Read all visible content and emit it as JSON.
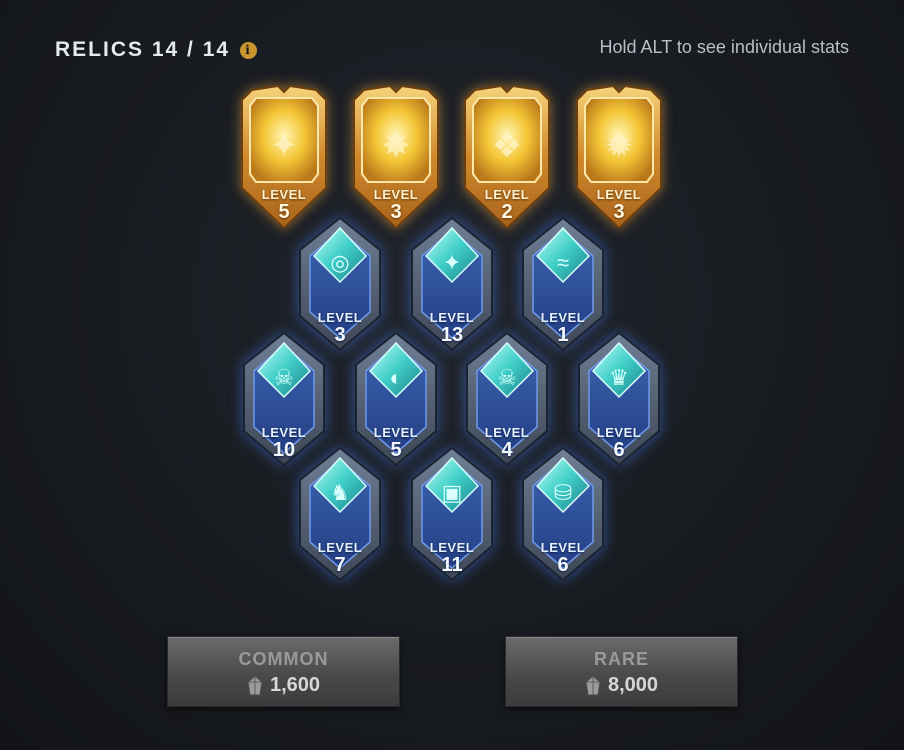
{
  "header": {
    "title": "RELICS 14 / 14",
    "hint": "Hold ALT to see individual stats"
  },
  "level_label": "LEVEL",
  "relics": {
    "gold": [
      {
        "level": "5"
      },
      {
        "level": "3"
      },
      {
        "level": "2"
      },
      {
        "level": "3"
      }
    ],
    "row1": [
      {
        "level": "3"
      },
      {
        "level": "13"
      },
      {
        "level": "1"
      }
    ],
    "row2": [
      {
        "level": "10"
      },
      {
        "level": "5"
      },
      {
        "level": "4"
      },
      {
        "level": "6"
      }
    ],
    "row3": [
      {
        "level": "7"
      },
      {
        "level": "11"
      },
      {
        "level": "6"
      }
    ]
  },
  "buttons": {
    "common": {
      "label": "COMMON",
      "price": "1,600"
    },
    "rare": {
      "label": "RARE",
      "price": "8,000"
    }
  },
  "colors": {
    "gold_relic": "#e8a93a",
    "blue_relic": "#3a63b8",
    "gem_teal": "#37c8c4"
  }
}
